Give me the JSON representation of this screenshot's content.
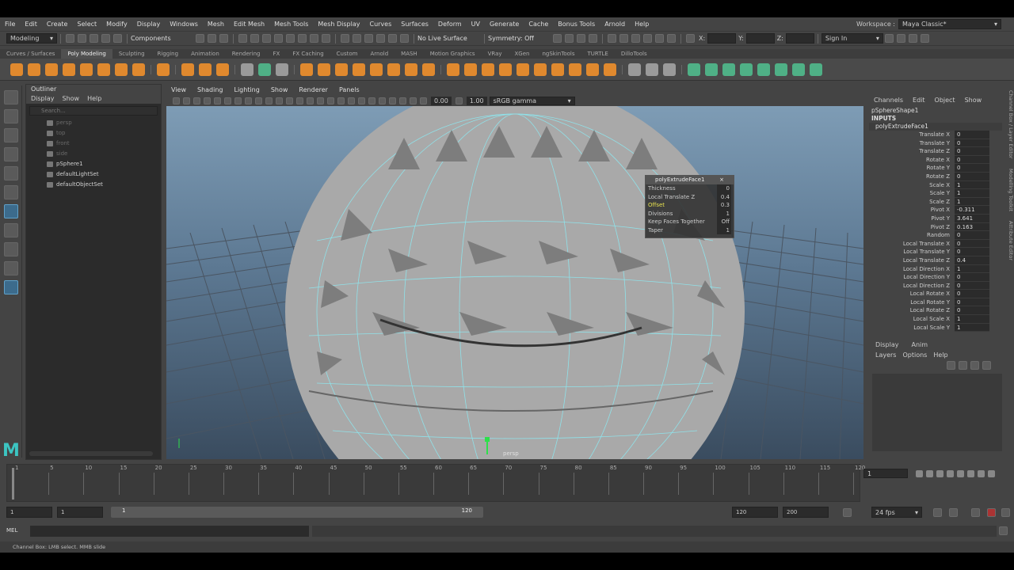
{
  "menubar": {
    "items": [
      "File",
      "Edit",
      "Create",
      "Select",
      "Modify",
      "Display",
      "Windows",
      "Mesh",
      "Edit Mesh",
      "Mesh Tools",
      "Mesh Display",
      "Curves",
      "Surfaces",
      "Deform",
      "UV",
      "Generate",
      "Cache",
      "Bonus Tools",
      "Arnold",
      "Help"
    ],
    "workspace_label": "Workspace :",
    "workspace_value": "Maya Classic*"
  },
  "statusline": {
    "mode": "Modeling",
    "components": "Components",
    "live_surface": "No Live Surface",
    "symmetry": "Symmetry: Off",
    "x_label": "X:",
    "y_label": "Y:",
    "z_label": "Z:",
    "sign_in": "Sign In"
  },
  "shelf": {
    "tabs": [
      "Curves / Surfaces",
      "Poly Modeling",
      "Sculpting",
      "Rigging",
      "Animation",
      "Rendering",
      "FX",
      "FX Caching",
      "Custom",
      "Arnold",
      "MASH",
      "Motion Graphics",
      "VRay",
      "XGen",
      "ngSkinTools",
      "TURTLE",
      "DilloTools"
    ],
    "active": "Poly Modeling"
  },
  "outliner": {
    "title": "Outliner",
    "menu": [
      "Display",
      "Show",
      "Help"
    ],
    "search_placeholder": "Search...",
    "items": [
      "persp",
      "top",
      "front",
      "side",
      "pSphere1",
      "defaultLightSet",
      "defaultObjectSet"
    ]
  },
  "viewport": {
    "menu": [
      "View",
      "Shading",
      "Lighting",
      "Show",
      "Renderer",
      "Panels"
    ],
    "near": "0.00",
    "far": "1.00",
    "color_space": "sRGB gamma",
    "camera_label": "persp"
  },
  "popup": {
    "title": "polyExtrudeFace1",
    "rows": [
      {
        "k": "Thickness",
        "v": "0"
      },
      {
        "k": "Local Translate Z",
        "v": "0.4"
      },
      {
        "k": "Offset",
        "v": "0.3"
      },
      {
        "k": "Divisions",
        "v": "1"
      },
      {
        "k": "Keep Faces Together",
        "v": "Off"
      },
      {
        "k": "Taper",
        "v": "1"
      }
    ]
  },
  "channelbox": {
    "menu": [
      "Channels",
      "Edit",
      "Object",
      "Show"
    ],
    "node": "pSphereShape1",
    "inputs": "INPUTS",
    "op": "polyExtrudeFace1",
    "attrs": [
      {
        "k": "Translate X",
        "v": "0"
      },
      {
        "k": "Translate Y",
        "v": "0"
      },
      {
        "k": "Translate Z",
        "v": "0"
      },
      {
        "k": "Rotate X",
        "v": "0"
      },
      {
        "k": "Rotate Y",
        "v": "0"
      },
      {
        "k": "Rotate Z",
        "v": "0"
      },
      {
        "k": "Scale X",
        "v": "1"
      },
      {
        "k": "Scale Y",
        "v": "1"
      },
      {
        "k": "Scale Z",
        "v": "1"
      },
      {
        "k": "Pivot X",
        "v": "-0.311"
      },
      {
        "k": "Pivot Y",
        "v": "3.641"
      },
      {
        "k": "Pivot Z",
        "v": "0.163"
      },
      {
        "k": "Random",
        "v": "0"
      },
      {
        "k": "Local Translate X",
        "v": "0"
      },
      {
        "k": "Local Translate Y",
        "v": "0"
      },
      {
        "k": "Local Translate Z",
        "v": "0.4"
      },
      {
        "k": "Local Direction X",
        "v": "1"
      },
      {
        "k": "Local Direction Y",
        "v": "0"
      },
      {
        "k": "Local Direction Z",
        "v": "0"
      },
      {
        "k": "Local Rotate X",
        "v": "0"
      },
      {
        "k": "Local Rotate Y",
        "v": "0"
      },
      {
        "k": "Local Rotate Z",
        "v": "0"
      },
      {
        "k": "Local Scale X",
        "v": "1"
      },
      {
        "k": "Local Scale Y",
        "v": "1"
      }
    ]
  },
  "sidetabs": [
    "Channel Box / Layer Editor",
    "Modelling Toolkit",
    "Attribute Editor"
  ],
  "layer_editor": {
    "tabs": [
      "Display",
      "Anim"
    ],
    "menu": [
      "Layers",
      "Options",
      "Help"
    ]
  },
  "timeline": {
    "labels": [
      "1",
      "5",
      "10",
      "15",
      "20",
      "25",
      "30",
      "35",
      "40",
      "45",
      "50",
      "55",
      "60",
      "65",
      "70",
      "75",
      "80",
      "85",
      "90",
      "95",
      "100",
      "105",
      "110",
      "115",
      "120"
    ],
    "current_frame": "1"
  },
  "range": {
    "start": "1",
    "inner_start": "1",
    "slider_start": "1",
    "slider_end": "120",
    "end": "120",
    "anim_end": "200",
    "fps": "24 fps"
  },
  "cmd": {
    "mel": "MEL"
  },
  "helpline": "Channel Box: LMB select. MMB slide"
}
